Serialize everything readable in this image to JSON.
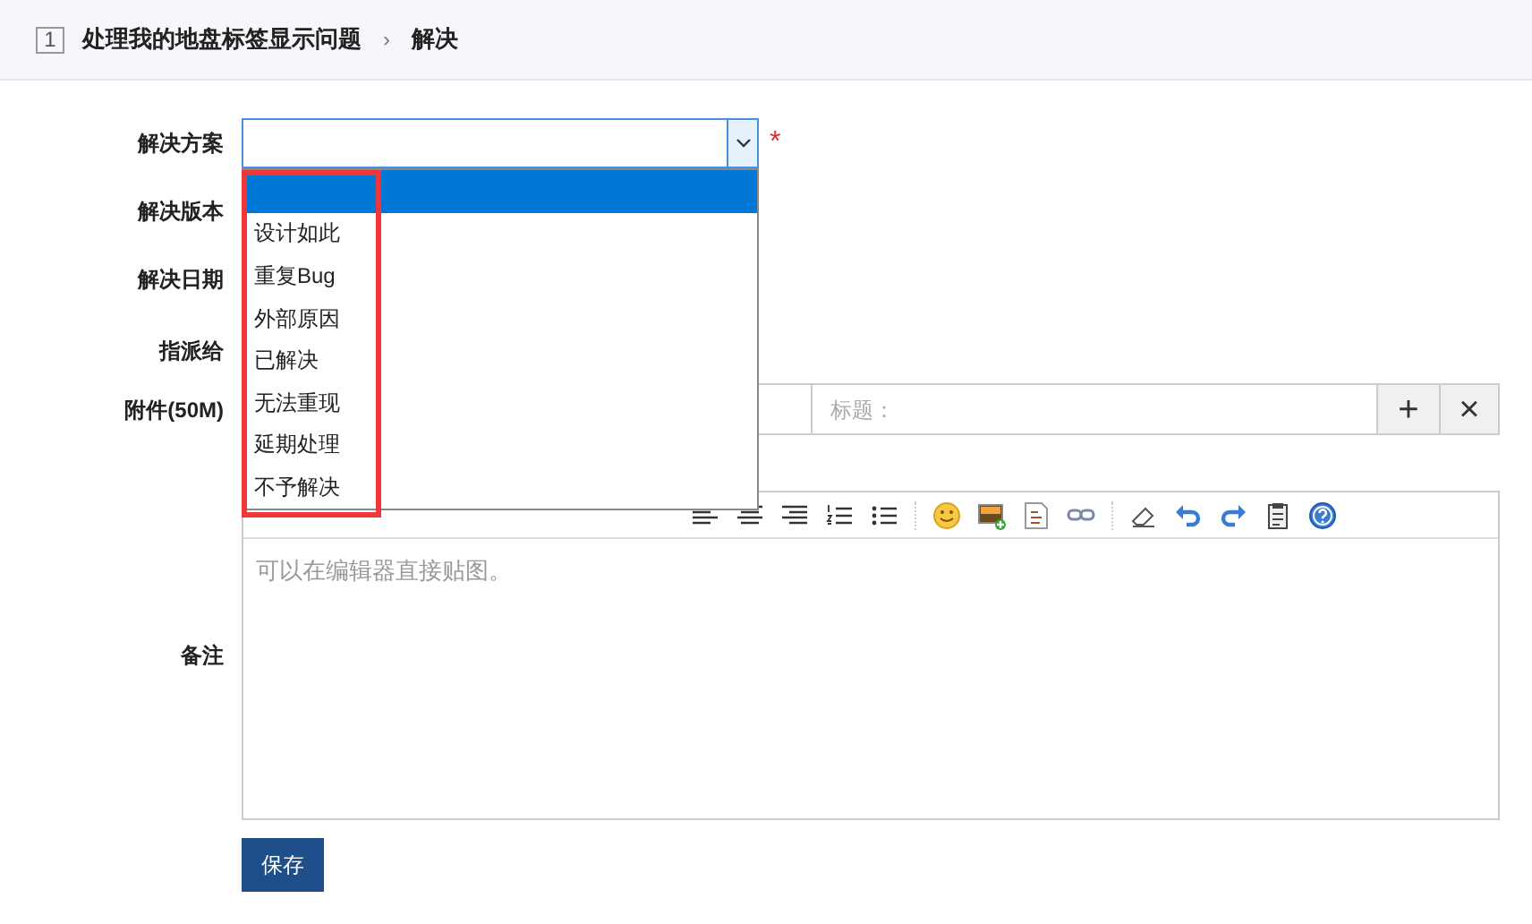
{
  "header": {
    "index": "1",
    "title": "处理我的地盘标签显示问题",
    "separator": "›",
    "action": "解决"
  },
  "resolution": {
    "label": "解决方案",
    "required_mark": "*",
    "options": [
      {
        "selected": true
      },
      {
        "label": "设计如此",
        "selected": false
      },
      {
        "label": "重复Bug",
        "selected": false
      },
      {
        "label": "外部原因",
        "selected": false
      },
      {
        "label": "已解决",
        "selected": false
      },
      {
        "label": "无法重现",
        "selected": false
      },
      {
        "label": "延期处理",
        "selected": false
      },
      {
        "label": "不予解决",
        "selected": false
      }
    ]
  },
  "rows": [
    {
      "label": "解决版本"
    },
    {
      "label": "解决日期"
    },
    {
      "label": "指派给"
    }
  ],
  "attachment": {
    "label": "附件(50M)",
    "title_placeholder": "标题：",
    "add": "+",
    "remove": "×"
  },
  "note": {
    "label": "备注",
    "placeholder": "可以在编辑器直接贴图。"
  },
  "save": "保存"
}
